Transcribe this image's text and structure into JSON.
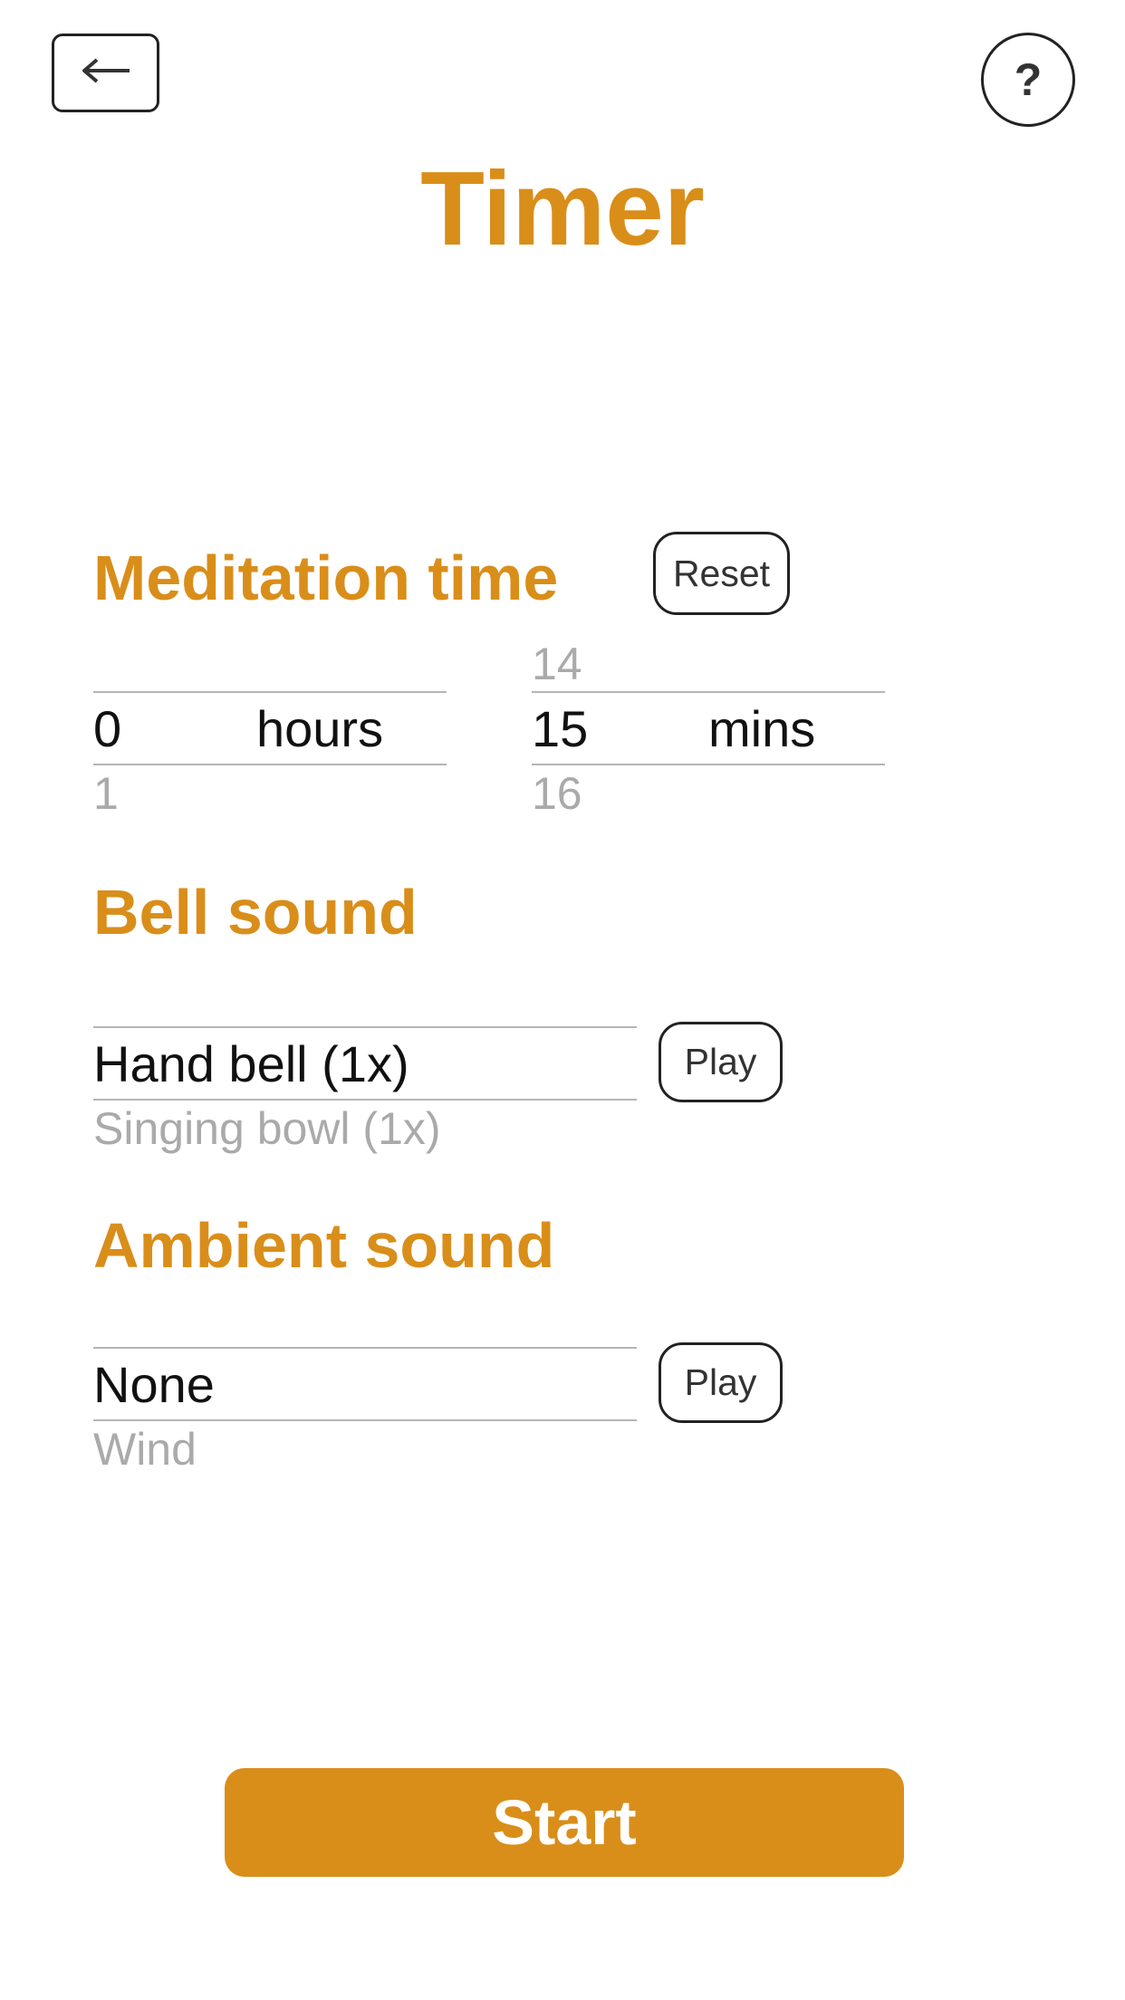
{
  "header": {
    "title": "Timer",
    "back_icon": "arrow-left-icon",
    "help_label": "?"
  },
  "meditation": {
    "title": "Meditation time",
    "reset_label": "Reset",
    "hours": {
      "above": "",
      "selected": "0",
      "unit": "hours",
      "below": "1"
    },
    "mins": {
      "above": "14",
      "selected": "15",
      "unit": "mins",
      "below": "16"
    }
  },
  "bell": {
    "title": "Bell sound",
    "selected": "Hand bell (1x)",
    "next": "Singing bowl (1x)",
    "play_label": "Play"
  },
  "ambient": {
    "title": "Ambient sound",
    "selected": "None",
    "next": "Wind",
    "play_label": "Play"
  },
  "start_label": "Start",
  "colors": {
    "accent": "#d98e1a",
    "text": "#111111",
    "faded": "#aaaaaa",
    "divider": "#b5b5b5"
  }
}
